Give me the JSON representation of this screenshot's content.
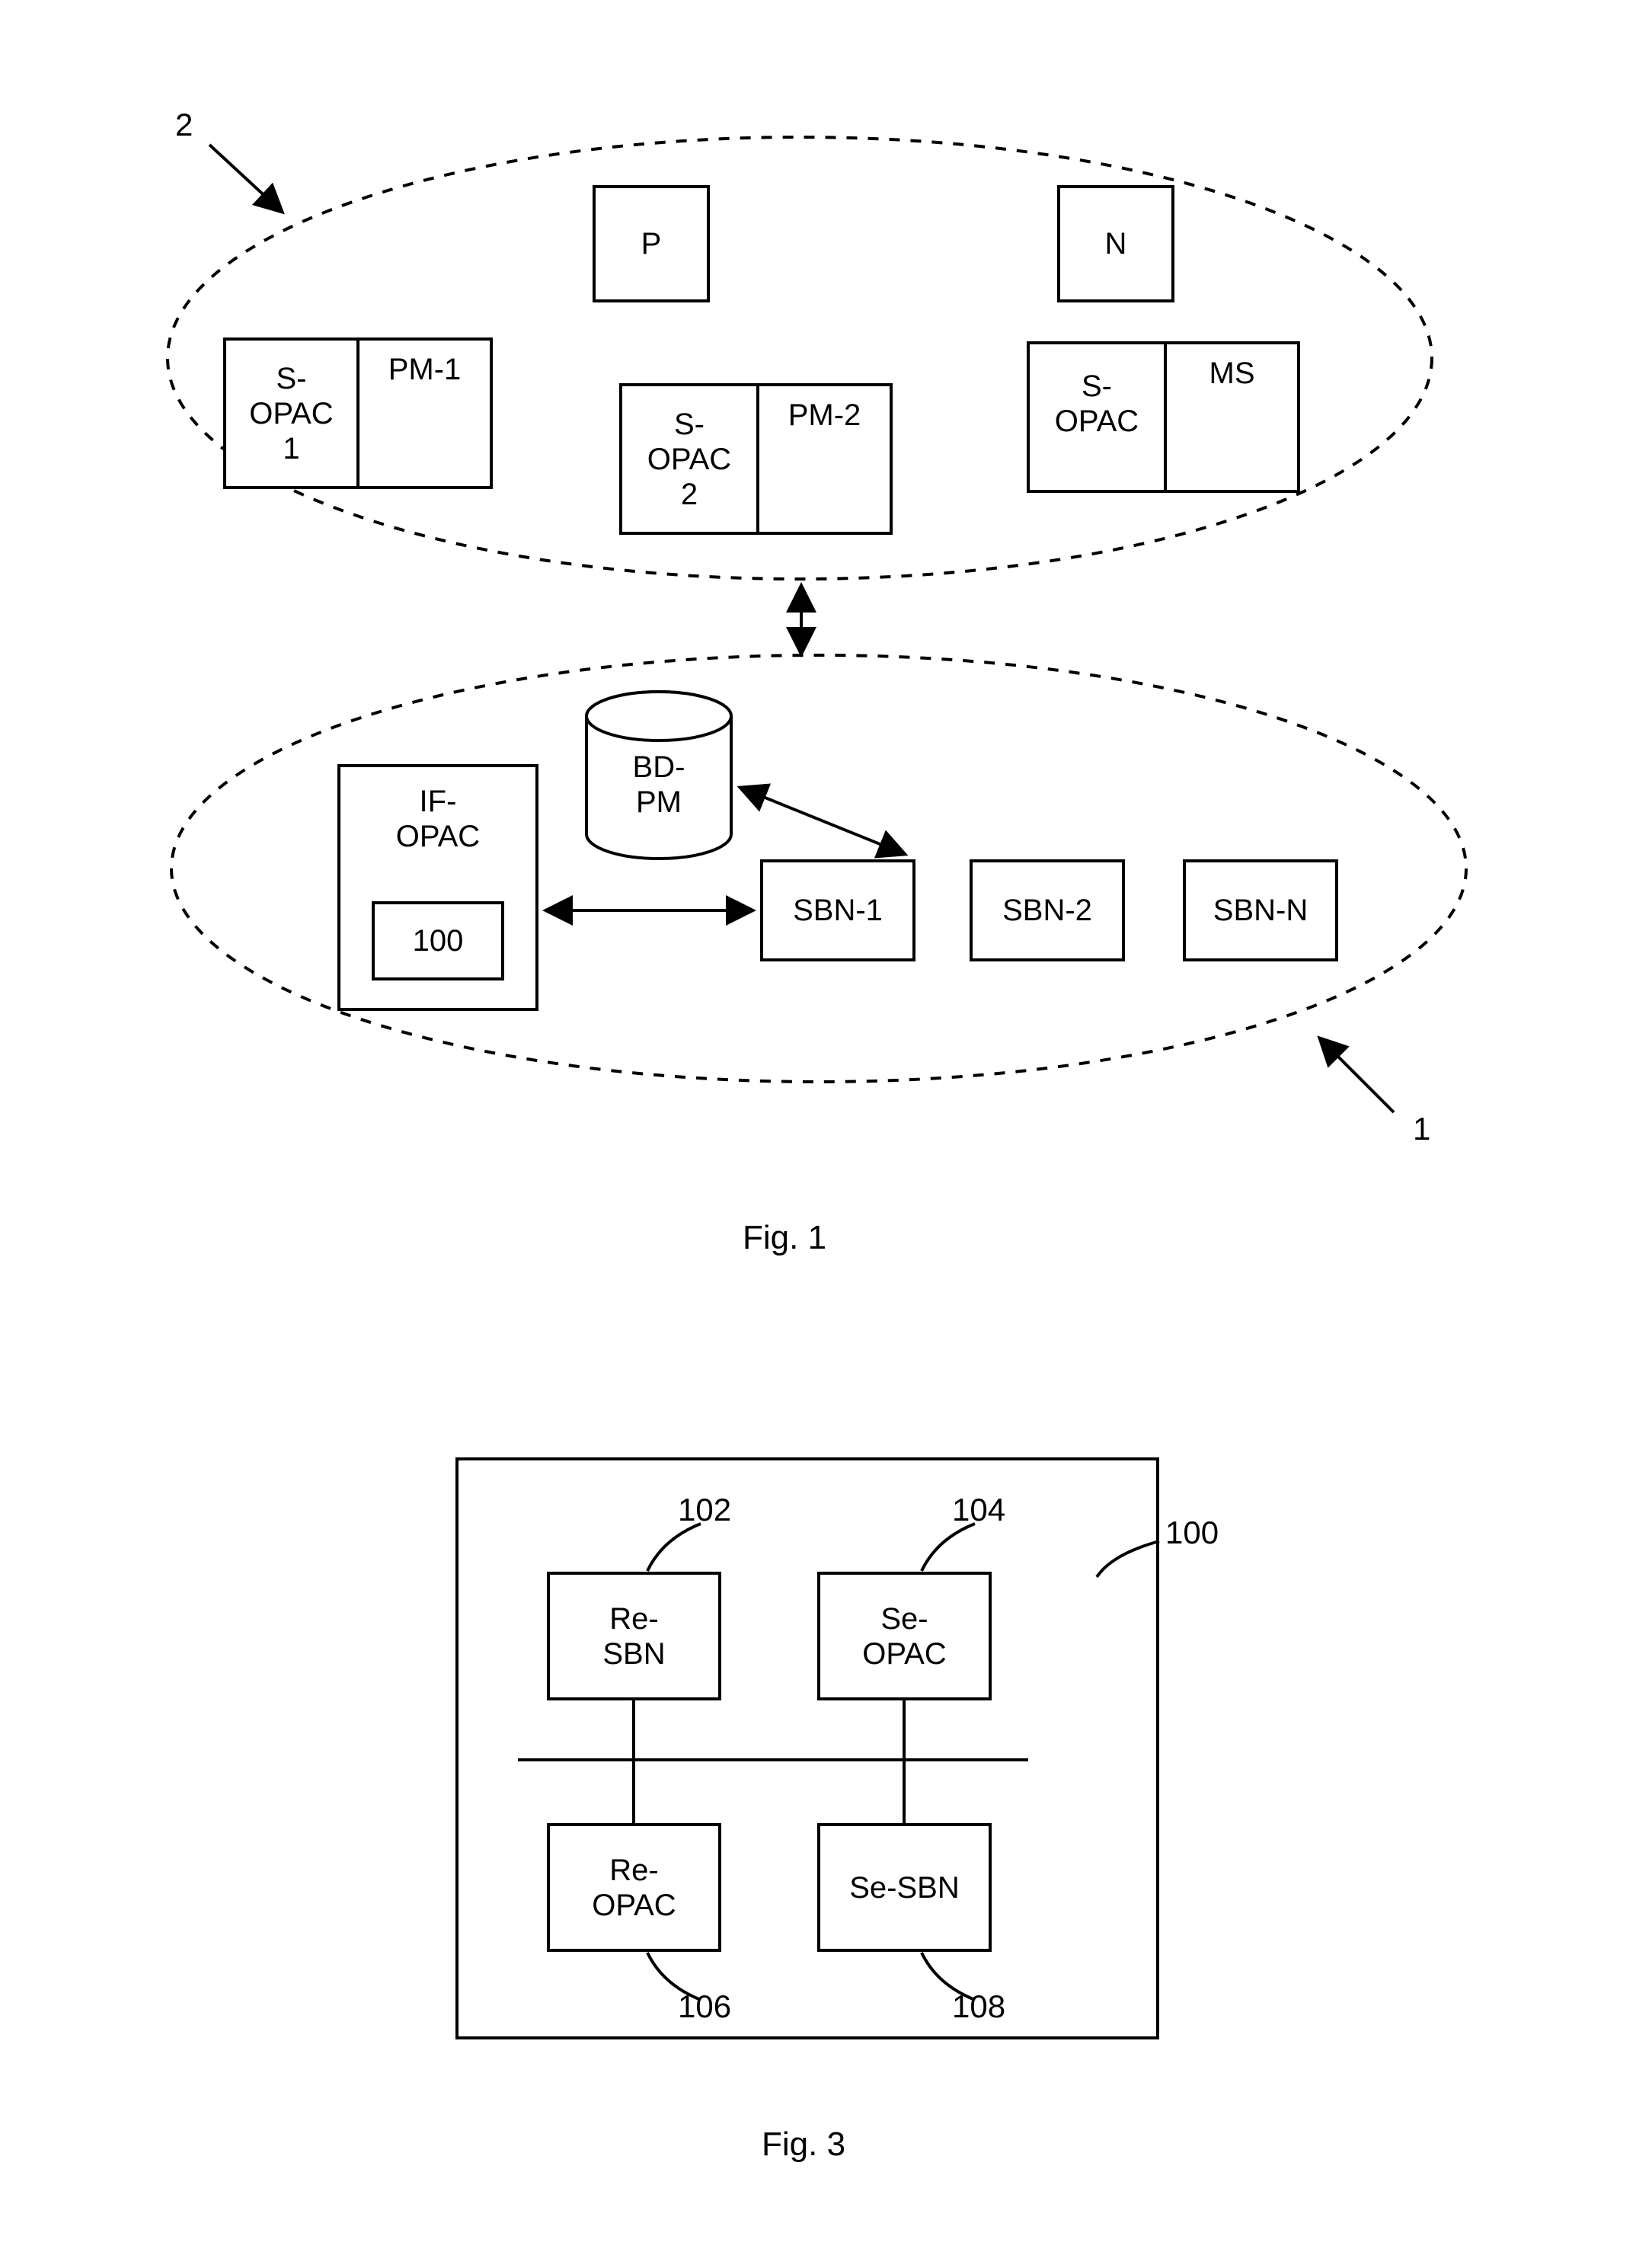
{
  "fig1": {
    "caption": "Fig. 1",
    "outer_label_top": "2",
    "outer_label_bottom": "1",
    "top_ellipse": {
      "box_P": "P",
      "box_N": "N",
      "pair1": {
        "left": "S-\nOPAC\n1",
        "right": "PM-1"
      },
      "pair2": {
        "left": "S-\nOPAC\n2",
        "right": "PM-2"
      },
      "pair3": {
        "left": "S-\nOPAC",
        "right": "MS"
      }
    },
    "bottom_ellipse": {
      "cylinder": "BD-\nPM",
      "if_opac": {
        "label": "IF-\nOPAC",
        "inner": "100"
      },
      "sbn1": "SBN-1",
      "sbn2": "SBN-2",
      "sbnN": "SBN-N"
    }
  },
  "fig3": {
    "caption": "Fig. 3",
    "outer_ref": "100",
    "ref_102": "102",
    "ref_104": "104",
    "ref_106": "106",
    "ref_108": "108",
    "box_re_sbn": "Re-\nSBN",
    "box_se_opac": "Se-\nOPAC",
    "box_re_opac": "Re-\nOPAC",
    "box_se_sbn": "Se-SBN"
  }
}
